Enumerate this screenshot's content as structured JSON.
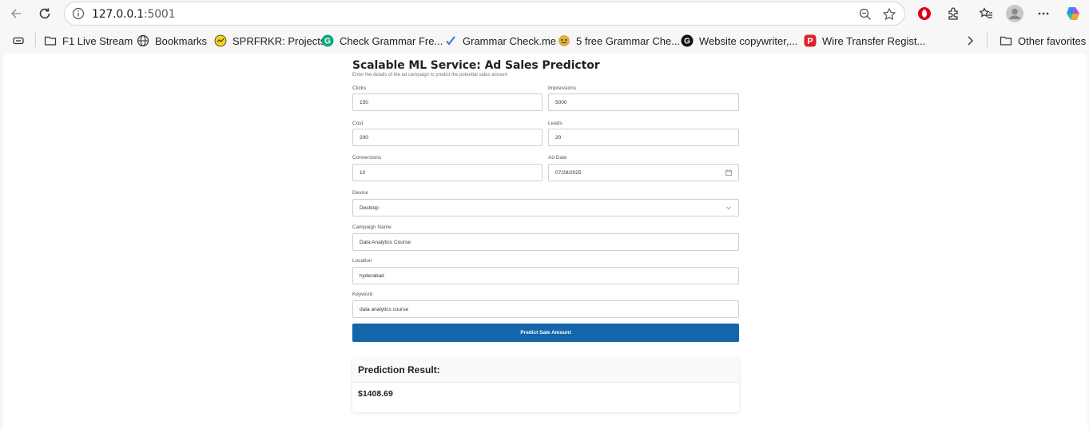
{
  "browser": {
    "url_host": "127.0.0.1",
    "url_port": ":5001",
    "bookmarks": [
      {
        "label": "F1 Live Stream",
        "icon": "folder-icon"
      },
      {
        "label": "Bookmarks",
        "icon": "globe-icon"
      },
      {
        "label": "SPRFRKR: Projects",
        "icon": "yellow-site-icon"
      },
      {
        "label": "Check Grammar Fre...",
        "icon": "grammar-g-icon"
      },
      {
        "label": "Grammar Check.me",
        "icon": "checkmark-icon"
      },
      {
        "label": "5 free Grammar Che...",
        "icon": "emoji-icon"
      },
      {
        "label": "Website copywriter,...",
        "icon": "g-black-icon"
      },
      {
        "label": "Wire Transfer Regist...",
        "icon": "p-red-icon"
      }
    ],
    "other_favorites": "Other favorites"
  },
  "page": {
    "title": "Scalable ML Service: Ad Sales Predictor",
    "subtitle": "Enter the details of the ad campaign to predict the potential sales amount",
    "fields": {
      "clicks": {
        "label": "Clicks",
        "value": "150"
      },
      "impressions": {
        "label": "Impressions",
        "value": "5000"
      },
      "cost": {
        "label": "Cost",
        "value": "200"
      },
      "leads": {
        "label": "Leads",
        "value": "20"
      },
      "conversions": {
        "label": "Conversions",
        "value": "10"
      },
      "ad_date": {
        "label": "Ad Date",
        "value": "07/28/2025"
      },
      "device": {
        "label": "Device",
        "value": "Desktop"
      },
      "campaign_name": {
        "label": "Campaign Name",
        "value": "Data Analytics Course"
      },
      "location": {
        "label": "Location",
        "value": "hyderabad"
      },
      "keyword": {
        "label": "Keyword",
        "value": "data analytics course"
      }
    },
    "submit_label": "Predict Sale Amount",
    "result": {
      "heading": "Prediction Result:",
      "value": "$1408.69"
    }
  },
  "colors": {
    "accent": "#1466ab",
    "opera_red": "#e0001b",
    "bookmark_red": "#e0202a"
  }
}
